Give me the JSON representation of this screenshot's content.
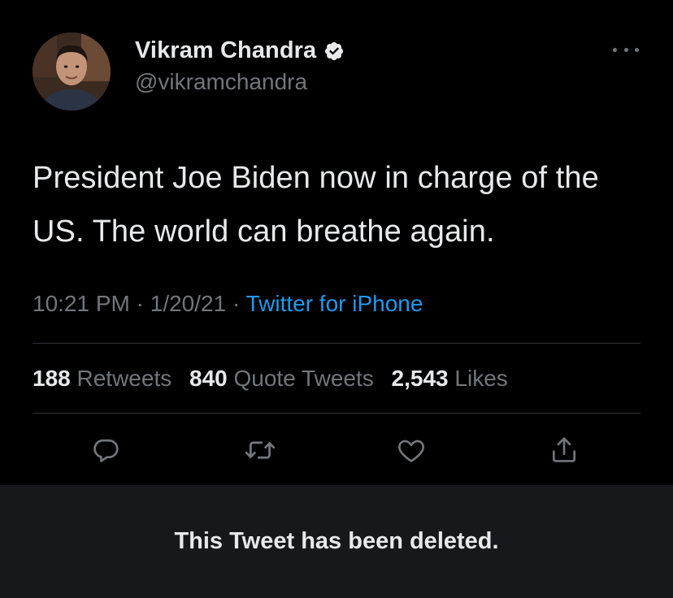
{
  "author": {
    "display_name": "Vikram Chandra",
    "handle": "@vikramchandra",
    "verified_icon": "verified-badge-icon"
  },
  "tweet": {
    "text": "President Joe Biden now in charge of the US. The world can breathe again.",
    "time": "10:21 PM",
    "separator": "·",
    "date": "1/20/21",
    "source": "Twitter for iPhone"
  },
  "stats": {
    "retweets_count": "188",
    "retweets_label": "Retweets",
    "quotes_count": "840",
    "quotes_label": "Quote Tweets",
    "likes_count": "2,543",
    "likes_label": "Likes"
  },
  "actions": {
    "icons": [
      "reply-icon",
      "retweet-icon",
      "like-icon",
      "share-icon"
    ]
  },
  "banner": {
    "message": "This Tweet has been deleted."
  },
  "colors": {
    "background": "#000000",
    "primary_text": "#e7e9ea",
    "secondary_text": "#71767b",
    "accent": "#1d9bf0",
    "divider": "#2f3336",
    "banner_bg": "#16181c"
  }
}
